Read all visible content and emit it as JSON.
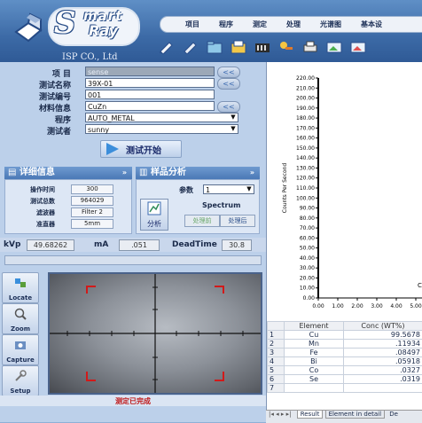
{
  "header": {
    "logo_big": "S",
    "logo_mart": "mart",
    "logo_ray": "Ray",
    "company": "ISP CO., Ltd",
    "menu": [
      "项目",
      "程序",
      "测定",
      "处理",
      "光谱图",
      "基本设"
    ]
  },
  "toolbar": {
    "icons": [
      "edit-icon",
      "edit-icon",
      "folder-icon",
      "folder-icon",
      "calculator-icon",
      "keys-icon",
      "print-icon",
      "image-icon",
      "image-icon"
    ]
  },
  "form": {
    "project_label": "项 目",
    "project_value": "sense",
    "name_label": "测试名称",
    "name_value": "39X-01",
    "code_label": "测试编号",
    "code_value": "001",
    "material_label": "材料信息",
    "material_value": "CuZn",
    "program_label": "程序",
    "program_value": "AUTO_METAL",
    "tester_label": "测试者",
    "tester_value": "sunny",
    "start_button": "测试开始",
    "double_arrow": "<<"
  },
  "details": {
    "title": "详细信息",
    "rows": [
      {
        "label": "操作时间",
        "value": "300"
      },
      {
        "label": "测试总数",
        "value": "964029"
      },
      {
        "label": "滤波器",
        "value": "Filter 2"
      },
      {
        "label": "准直器",
        "value": "5mm"
      }
    ]
  },
  "analysis": {
    "title": "样品分析",
    "param_label": "参数",
    "param_value": "1",
    "analyze_button": "分析",
    "spectrum_label": "Spectrum",
    "pre_process": "处理前",
    "post_process": "处理后"
  },
  "readouts": {
    "kvp_label": "kVp",
    "kvp_value": "49.68262",
    "ma_label": "mA",
    "ma_value": ".051",
    "deadtime_label": "DeadTime",
    "deadtime_value": "30.8"
  },
  "side_tools": [
    {
      "label": "Locate",
      "icon": "locate-icon"
    },
    {
      "label": "Zoom",
      "icon": "zoom-icon"
    },
    {
      "label": "Capture",
      "icon": "capture-icon"
    },
    {
      "label": "Setup",
      "icon": "setup-icon"
    }
  ],
  "status": "测定已完成",
  "chart_data": {
    "type": "line",
    "ylabel": "Counts Per Second",
    "ylim": [
      0,
      220
    ],
    "yticks": [
      "220.00",
      "210.00",
      "200.00",
      "190.00",
      "180.00",
      "170.00",
      "160.00",
      "150.00",
      "140.00",
      "130.00",
      "120.00",
      "110.00",
      "100.00",
      "90.00",
      "80.00",
      "70.00",
      "60.00",
      "50.00",
      "40.00",
      "30.00",
      "20.00",
      "10.00",
      "0.00"
    ],
    "xticks": [
      "0.00",
      "1.00",
      "2.00",
      "3.00",
      "4.00",
      "5.00"
    ],
    "xlim": [
      0,
      5
    ],
    "series": [],
    "annotation": "C"
  },
  "results": {
    "headers": [
      "",
      "Element",
      "Conc (WT%)"
    ],
    "rows": [
      {
        "n": "1",
        "el": "Cu",
        "conc": "99.5678"
      },
      {
        "n": "2",
        "el": "Mn",
        "conc": ".11934"
      },
      {
        "n": "3",
        "el": "Fe",
        "conc": ".08497"
      },
      {
        "n": "4",
        "el": "Bi",
        "conc": ".05918"
      },
      {
        "n": "5",
        "el": "Co",
        "conc": ".0327"
      },
      {
        "n": "6",
        "el": "Se",
        "conc": ".0319"
      },
      {
        "n": "7",
        "el": "",
        "conc": ""
      }
    ],
    "tabs": [
      "Result",
      "Element in detail",
      "De"
    ]
  },
  "colors": {
    "accent": "#4a78b6",
    "status": "#c01818",
    "frame_marker": "#d21a1a"
  }
}
